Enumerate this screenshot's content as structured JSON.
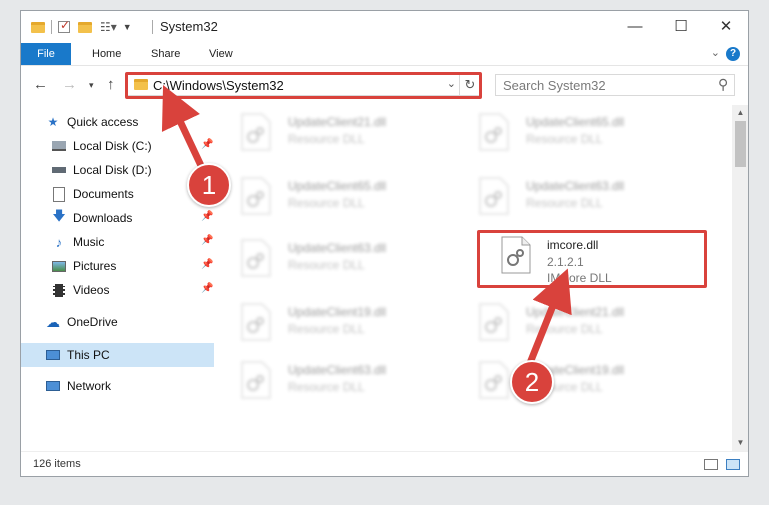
{
  "window": {
    "title": "System32",
    "controls": {
      "minimize": "—",
      "maximize": "☐",
      "close": "✕"
    }
  },
  "ribbon": {
    "tabs": [
      {
        "label": "File"
      },
      {
        "label": "Home"
      },
      {
        "label": "Share"
      },
      {
        "label": "View"
      }
    ],
    "help": "?"
  },
  "address": {
    "path": "C:\\Windows\\System32",
    "search_placeholder": "Search System32"
  },
  "nav": {
    "quick_access": "Quick access",
    "items": [
      {
        "label": "Local Disk (C:)",
        "icon": "drive-icon",
        "pinned": true
      },
      {
        "label": "Local Disk (D:)",
        "icon": "drive-icon",
        "pinned": false
      },
      {
        "label": "Documents",
        "icon": "documents-icon",
        "pinned": true
      },
      {
        "label": "Downloads",
        "icon": "download-icon",
        "pinned": true
      },
      {
        "label": "Music",
        "icon": "music-icon",
        "pinned": true
      },
      {
        "label": "Pictures",
        "icon": "pictures-icon",
        "pinned": true
      },
      {
        "label": "Videos",
        "icon": "videos-icon",
        "pinned": true
      }
    ],
    "onedrive": "OneDrive",
    "this_pc": "This PC",
    "network": "Network"
  },
  "files": {
    "blurred": [
      {
        "name": "UpdateClient21.dll",
        "type": "Resource DLL"
      },
      {
        "name": "UpdateClient65.dll",
        "type": "Resource DLL"
      },
      {
        "name": "UpdateClient65.dll",
        "type": "Resource DLL"
      },
      {
        "name": "UpdateClient63.dll",
        "type": "Resource DLL"
      },
      {
        "name": "UpdateClient63.dll",
        "type": "Resource DLL"
      },
      {
        "name": "UpdateClient19.dll",
        "type": "Resource DLL"
      },
      {
        "name": "UpdateClient21.dll",
        "type": "Resource DLL"
      },
      {
        "name": "UpdateClient63.dll",
        "type": "Resource DLL"
      },
      {
        "name": "UpdateClient19.dll",
        "type": "Resource DLL"
      }
    ],
    "highlighted": {
      "name": "imcore.dll",
      "version": "2.1.2.1",
      "description": "IMCore DLL"
    }
  },
  "status": {
    "count": "126 items"
  },
  "badges": {
    "one": "1",
    "two": "2"
  },
  "colors": {
    "accent": "#1979ca",
    "highlight": "#d9423c",
    "selection": "#cce4f7"
  }
}
